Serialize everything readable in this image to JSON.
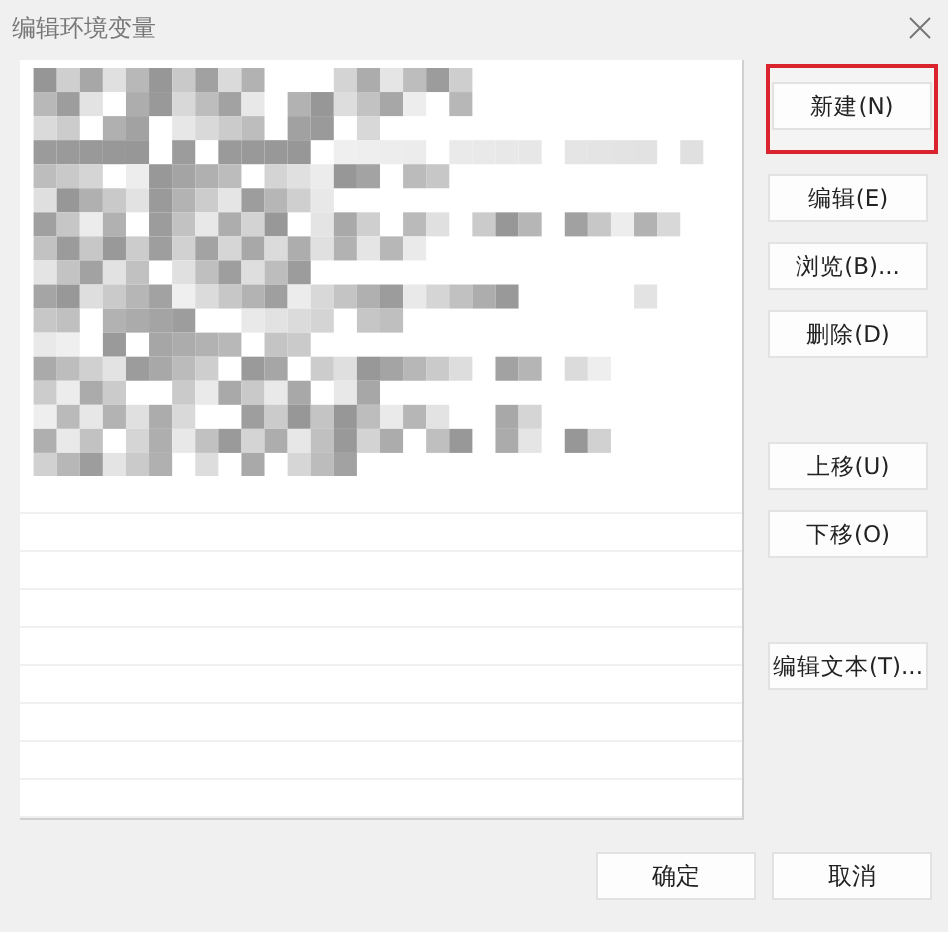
{
  "window": {
    "title": "编辑环境变量"
  },
  "list": {
    "kind": "pixelated"
  },
  "side_button_groups": [
    [
      {
        "label": "新建(N)",
        "highlighted": true
      },
      {
        "label": "编辑(E)",
        "highlighted": false
      },
      {
        "label": "浏览(B)...",
        "highlighted": false
      },
      {
        "label": "删除(D)",
        "highlighted": false
      }
    ],
    [
      {
        "label": "上移(U)",
        "highlighted": false
      },
      {
        "label": "下移(O)",
        "highlighted": false
      }
    ],
    [
      {
        "label": "编辑文本(T)...",
        "highlighted": false
      }
    ]
  ],
  "dialog_buttons": [
    {
      "label": "确定"
    },
    {
      "label": "取消"
    }
  ]
}
